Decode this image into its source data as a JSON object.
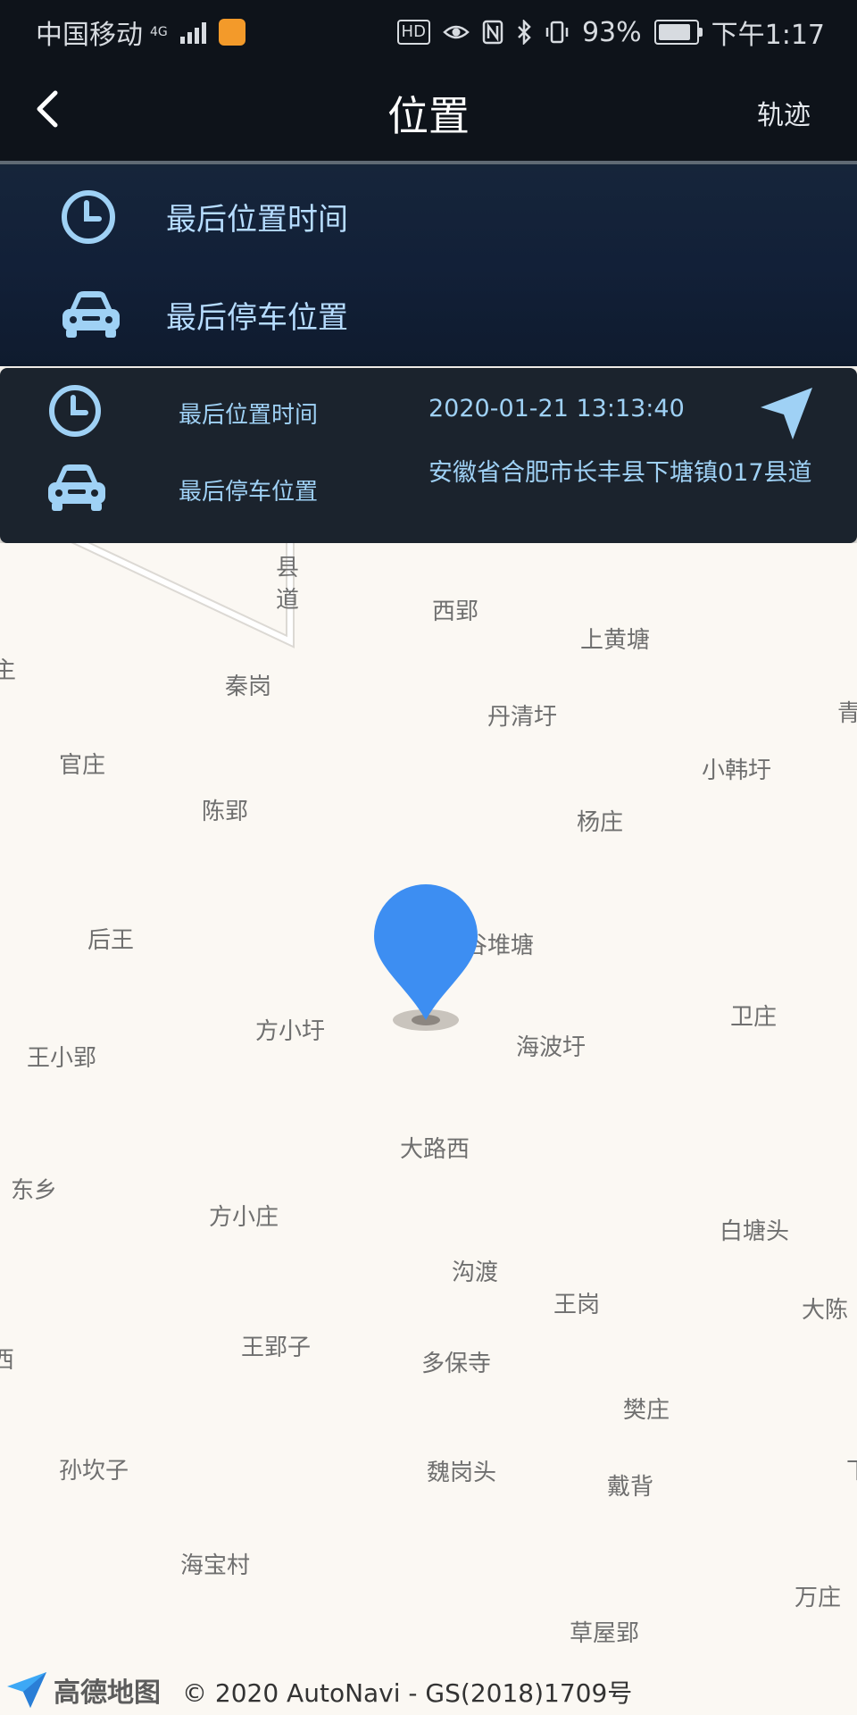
{
  "status_bar": {
    "carrier": "中国移动",
    "network": "4G",
    "hd": "HD",
    "battery_percent": "93%",
    "battery_level": 0.93,
    "time": "下午1:17",
    "icons": [
      "signal-icon",
      "uc-browser-icon",
      "hd-icon",
      "eye-icon",
      "nfc-icon",
      "bluetooth-icon",
      "vibrate-icon",
      "battery-icon"
    ]
  },
  "titlebar": {
    "back_icon": "chevron-left-icon",
    "title": "位置",
    "track_label": "轨迹"
  },
  "legend": {
    "time_label": "最后位置时间",
    "parking_label": "最后停车位置"
  },
  "info_card": {
    "time_label": "最后位置时间",
    "time_value": "2020-01-21 13:13:40",
    "parking_label": "最后停车位置",
    "parking_value": "安徽省合肥市长丰县下塘镇017县道",
    "nav_icon": "navigation-arrow-icon"
  },
  "map": {
    "road_label": "县道",
    "places": [
      "西郢",
      "上黄塘",
      "主",
      "秦岗",
      "丹清圩",
      "青",
      "官庄",
      "小韩圩",
      "陈郢",
      "杨庄",
      "后王",
      "谷堆塘",
      "方小圩",
      "卫庄",
      "王小郢",
      "海波圩",
      "大路西",
      "东乡",
      "方小庄",
      "白塘头",
      "沟渡",
      "王岗",
      "大陈",
      "西",
      "王郢子",
      "多保寺",
      "樊庄",
      "孙坎子",
      "魏岗头",
      "戴背",
      "下",
      "海宝村",
      "万庄",
      "草屋郢"
    ]
  },
  "footer": {
    "logo_text": "高德地图",
    "copyright": "© 2020 AutoNavi - GS(2018)1709号"
  },
  "colors": {
    "header_bg": "#0e131a",
    "accent_blue": "#9fd1f5",
    "marker_blue": "#3d8ef2",
    "map_bg": "#fbf8f3"
  }
}
